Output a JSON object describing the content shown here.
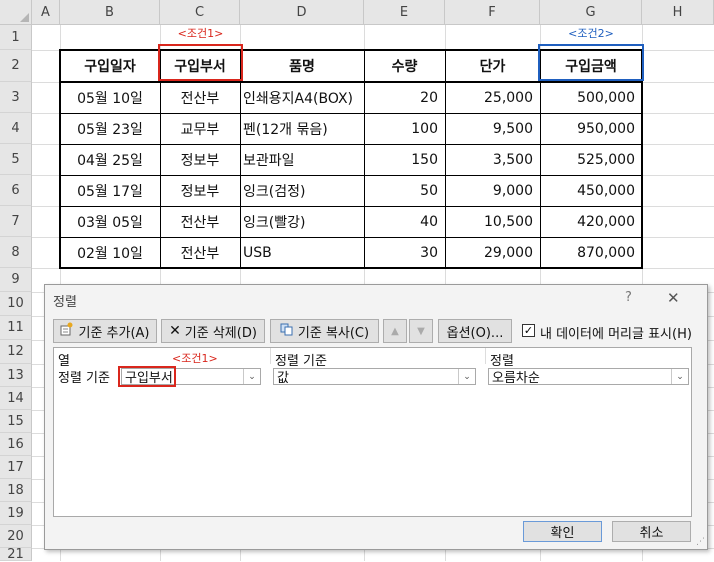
{
  "sheet": {
    "columns": [
      "A",
      "B",
      "C",
      "D",
      "E",
      "F",
      "G",
      "H"
    ],
    "rows": [
      "1",
      "2",
      "3",
      "4",
      "5",
      "6",
      "7",
      "8",
      "9",
      "10",
      "11",
      "12",
      "13",
      "14",
      "15",
      "16",
      "17",
      "18",
      "19",
      "20",
      "21"
    ]
  },
  "annotations": {
    "cond1_sheet": "<조건1>",
    "cond2_sheet": "<조건2>",
    "cond1_dialog": "<조건1>"
  },
  "colors": {
    "cond1": "#d9261c",
    "cond2": "#1f5fbf"
  },
  "table": {
    "headers": [
      "구입일자",
      "구입부서",
      "품명",
      "수량",
      "단가",
      "구입금액"
    ],
    "rows": [
      [
        "05월 10일",
        "전산부",
        "인쇄용지A4(BOX)",
        "20",
        "25,000",
        "500,000"
      ],
      [
        "05월 23일",
        "교무부",
        "펜(12개 묶음)",
        "100",
        "9,500",
        "950,000"
      ],
      [
        "04월 25일",
        "정보부",
        "보관파일",
        "150",
        "3,500",
        "525,000"
      ],
      [
        "05월 17일",
        "정보부",
        "잉크(검정)",
        "50",
        "9,000",
        "450,000"
      ],
      [
        "03월 05일",
        "전산부",
        "잉크(빨강)",
        "40",
        "10,500",
        "420,000"
      ],
      [
        "02월 10일",
        "전산부",
        "USB",
        "30",
        "29,000",
        "870,000"
      ]
    ]
  },
  "dialog": {
    "title": "정렬",
    "help": "?",
    "close": "✕",
    "add_level": "기준 추가(A)",
    "delete_level": "기준 삭제(D)",
    "copy_level": "기준 복사(C)",
    "options": "옵션(O)...",
    "has_headers": "내 데이터에 머리글 표시(H)",
    "has_headers_checked": true,
    "col_header": "열",
    "sort_on_header": "정렬 기준",
    "order_header": "정렬",
    "row_label": "정렬 기준",
    "column_value": "구입부서",
    "sort_on_value": "값",
    "order_value": "오름차순",
    "ok": "확인",
    "cancel": "취소"
  }
}
